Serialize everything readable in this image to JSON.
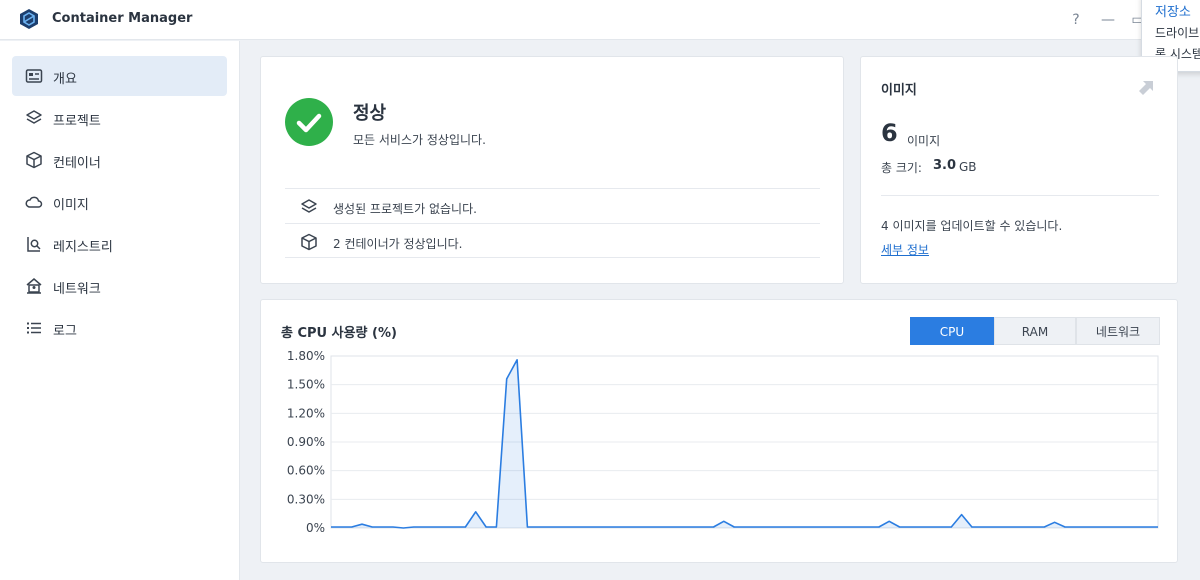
{
  "app": {
    "title": "Container Manager",
    "help_label": "?",
    "minimize_label": "—",
    "maximize_label": "▭"
  },
  "popover": {
    "title": "저장소",
    "line1": "드라이브",
    "line2": "록 시스템"
  },
  "sidebar": {
    "items": [
      {
        "label": "개요",
        "icon": "overview-icon",
        "active": true
      },
      {
        "label": "프로젝트",
        "icon": "layers-icon",
        "active": false
      },
      {
        "label": "컨테이너",
        "icon": "cube-icon",
        "active": false
      },
      {
        "label": "이미지",
        "icon": "cloud-icon",
        "active": false
      },
      {
        "label": "레지스트리",
        "icon": "registry-search-icon",
        "active": false
      },
      {
        "label": "네트워크",
        "icon": "network-house-icon",
        "active": false
      },
      {
        "label": "로그",
        "icon": "list-icon",
        "active": false
      }
    ]
  },
  "status": {
    "title": "정상",
    "subtitle": "모든 서비스가 정상입니다.",
    "rows": [
      {
        "text": "생성된 프로젝트가 없습니다.",
        "icon": "layers-icon"
      },
      {
        "text": "2 컨테이너가 정상입니다.",
        "icon": "cube-icon"
      }
    ],
    "color": "#2fb04a"
  },
  "images": {
    "title": "이미지",
    "count": "6",
    "count_label": "이미지",
    "size_label": "총 크기:",
    "size_value": "3.0",
    "size_unit": "GB",
    "update_text": "4 이미지를 업데이트할 수 있습니다.",
    "details_link": "세부 정보"
  },
  "cpu": {
    "title": "총 CPU 사용량 (%)",
    "tabs": [
      "CPU",
      "RAM",
      "네트워크"
    ],
    "active_tab": "CPU",
    "accent": "#2b7de1"
  },
  "chart_data": {
    "type": "area",
    "title": "총 CPU 사용량 (%)",
    "xlabel": "",
    "ylabel": "",
    "ylim": [
      0,
      1.8
    ],
    "yticks": [
      "1.80%",
      "1.50%",
      "1.20%",
      "0.90%",
      "0.60%",
      "0.30%",
      "0%"
    ],
    "grid": true,
    "series": [
      {
        "values": [
          0.01,
          0.01,
          0.01,
          0.04,
          0.01,
          0.01,
          0.01,
          0.0,
          0.01,
          0.01,
          0.01,
          0.01,
          0.01,
          0.01,
          0.17,
          0.01,
          0.01,
          1.56,
          1.76,
          0.01,
          0.01,
          0.01,
          0.01,
          0.01,
          0.01,
          0.01,
          0.01,
          0.01,
          0.01,
          0.01,
          0.01,
          0.01,
          0.01,
          0.01,
          0.01,
          0.01,
          0.01,
          0.01,
          0.07,
          0.01,
          0.01,
          0.01,
          0.01,
          0.01,
          0.01,
          0.01,
          0.01,
          0.01,
          0.01,
          0.01,
          0.01,
          0.01,
          0.01,
          0.01,
          0.07,
          0.01,
          0.01,
          0.01,
          0.01,
          0.01,
          0.01,
          0.14,
          0.01,
          0.01,
          0.01,
          0.01,
          0.01,
          0.01,
          0.01,
          0.01,
          0.06,
          0.01,
          0.01,
          0.01,
          0.01,
          0.01,
          0.01,
          0.01,
          0.01,
          0.01,
          0.01
        ]
      }
    ]
  }
}
